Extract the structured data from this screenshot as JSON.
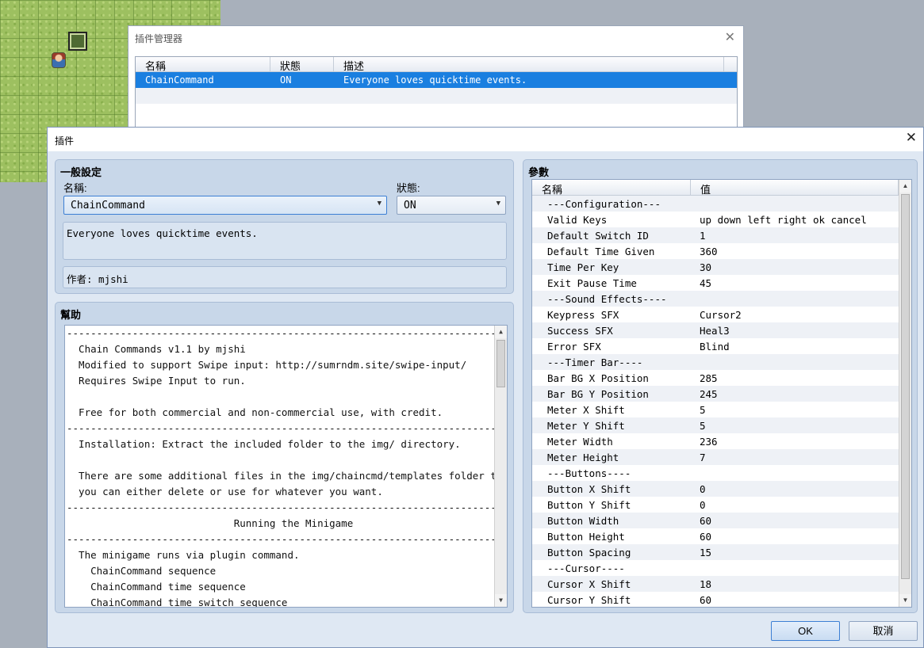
{
  "plugin_manager": {
    "title": "插件管理器",
    "columns": [
      "名稱",
      "狀態",
      "描述"
    ],
    "rows": [
      {
        "name": "ChainCommand",
        "status": "ON",
        "description": "Everyone loves quicktime events."
      }
    ]
  },
  "plugin_dialog": {
    "title": "插件",
    "general": {
      "title": "一般設定",
      "name_label": "名稱:",
      "name_value": "ChainCommand",
      "status_label": "狀態:",
      "status_value": "ON",
      "description": "Everyone loves quicktime events.",
      "author": "作者: mjshi"
    },
    "help": {
      "title": "幫助",
      "lines": [
        "----------------------------------------------------------------------------",
        "  Chain Commands v1.1 by mjshi",
        "  Modified to support Swipe input: http://sumrndm.site/swipe-input/",
        "  Requires Swipe Input to run.",
        "",
        "  Free for both commercial and non-commercial use, with credit.",
        "----------------------------------------------------------------------------",
        "  Installation: Extract the included folder to the img/ directory.",
        "",
        "  There are some additional files in the img/chaincmd/templates folder that",
        "  you can either delete or use for whatever you want.",
        "----------------------------------------------------------------------------",
        "                            Running the Minigame",
        "----------------------------------------------------------------------------",
        "  The minigame runs via plugin command.",
        "    ChainCommand sequence",
        "    ChainCommand time sequence",
        "    ChainCommand time switch sequence"
      ]
    },
    "params": {
      "title": "參數",
      "columns": [
        "名稱",
        "值"
      ],
      "rows": [
        {
          "name": "---Configuration---",
          "value": ""
        },
        {
          "name": "Valid Keys",
          "value": "up down left right ok cancel"
        },
        {
          "name": "Default Switch ID",
          "value": "1"
        },
        {
          "name": "Default Time Given",
          "value": "360"
        },
        {
          "name": "Time Per Key",
          "value": "30"
        },
        {
          "name": "Exit Pause Time",
          "value": "45"
        },
        {
          "name": "---Sound Effects----",
          "value": ""
        },
        {
          "name": "Keypress SFX",
          "value": "Cursor2"
        },
        {
          "name": "Success SFX",
          "value": "Heal3"
        },
        {
          "name": "Error SFX",
          "value": "Blind"
        },
        {
          "name": "---Timer Bar----",
          "value": ""
        },
        {
          "name": "Bar BG X Position",
          "value": "285"
        },
        {
          "name": "Bar BG Y Position",
          "value": "245"
        },
        {
          "name": "Meter X Shift",
          "value": "5"
        },
        {
          "name": "Meter Y Shift",
          "value": "5"
        },
        {
          "name": "Meter Width",
          "value": "236"
        },
        {
          "name": "Meter Height",
          "value": "7"
        },
        {
          "name": "---Buttons----",
          "value": ""
        },
        {
          "name": "Button X Shift",
          "value": "0"
        },
        {
          "name": "Button Y Shift",
          "value": "0"
        },
        {
          "name": "Button Width",
          "value": "60"
        },
        {
          "name": "Button Height",
          "value": "60"
        },
        {
          "name": "Button Spacing",
          "value": "15"
        },
        {
          "name": "---Cursor----",
          "value": ""
        },
        {
          "name": "Cursor X Shift",
          "value": "18"
        },
        {
          "name": "Cursor Y Shift",
          "value": "60"
        }
      ]
    },
    "buttons": {
      "ok": "OK",
      "cancel": "取消"
    }
  },
  "icons": {
    "close": "close-icon",
    "dropdown": "chevron-down-icon",
    "scroll_up": "arrow-up-icon",
    "scroll_down": "arrow-down-icon"
  },
  "colors": {
    "selection": "#1a7fe0",
    "group_bg": "#c8d7e9",
    "dialog_bg": "#dfe8f3"
  }
}
